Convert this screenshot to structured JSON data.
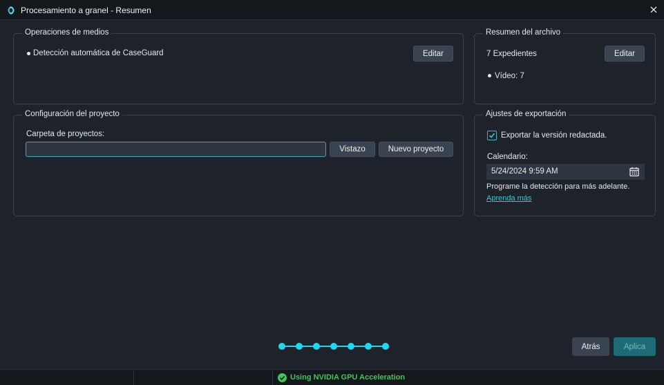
{
  "window": {
    "title": "Procesamiento a granel - Resumen",
    "icons": {
      "app": "caseguard-logo-icon",
      "close": "close-icon"
    }
  },
  "media_operations": {
    "legend": "Operaciones de medios",
    "items": [
      "Detección automática de CaseGuard"
    ],
    "edit_label": "Editar"
  },
  "file_summary": {
    "legend": "Resumen del archivo",
    "count_text": "7 Expedientes",
    "edit_label": "Editar",
    "items": [
      "Vídeo: 7"
    ]
  },
  "project_config": {
    "legend": "Configuración del proyecto",
    "folder_label": "Carpeta de proyectos:",
    "folder_value": "",
    "browse_label": "Vistazo",
    "new_project_label": "Nuevo proyecto"
  },
  "export_settings": {
    "legend": "Ajustes de exportación",
    "export_redacted_label": "Exportar la versión redactada.",
    "export_redacted_checked": true,
    "calendar_label": "Calendario:",
    "calendar_value": "5/24/2024 9:59 AM",
    "calendar_icon": "calendar-icon",
    "schedule_note": "Programe la detección para más adelante.",
    "learn_more": "Aprenda más"
  },
  "wizard": {
    "steps_total": 7,
    "steps_completed": 7
  },
  "footer": {
    "back_label": "Atrás",
    "apply_label": "Aplica"
  },
  "status": {
    "gpu_text": "Using NVIDIA GPU Acceleration"
  },
  "colors": {
    "accent": "#1fd8ee",
    "apply_bg": "#1d6b76",
    "status_green": "#45c45a",
    "background": "#1e232b"
  }
}
